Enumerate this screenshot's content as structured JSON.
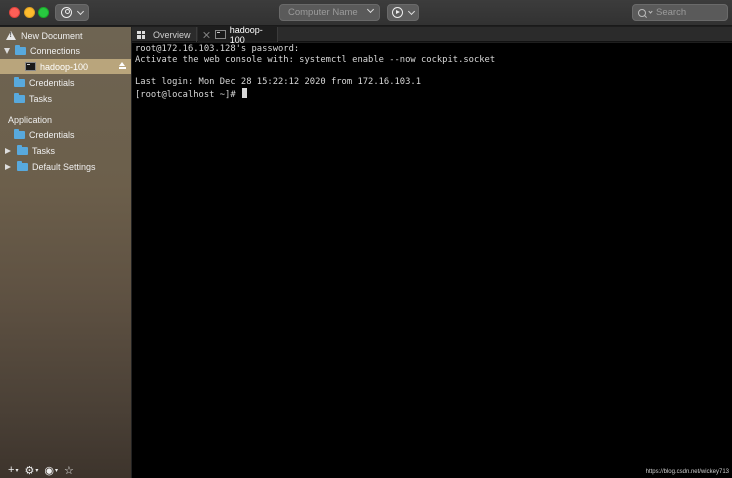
{
  "toolbar": {
    "computer_name_placeholder": "Computer Name",
    "search_placeholder": "Search"
  },
  "sidebar": {
    "new_document": "New Document",
    "connections_group": "Connections",
    "connection_items": [
      {
        "label": "hadoop-100",
        "icon": "terminal-icon",
        "selected": true
      },
      {
        "label": "Credentials",
        "icon": "folder-icon"
      },
      {
        "label": "Tasks",
        "icon": "folder-icon"
      }
    ],
    "application_header": "Application",
    "application_items": [
      {
        "label": "Credentials",
        "icon": "folder-icon"
      },
      {
        "label": "Tasks",
        "icon": "folder-icon",
        "disclosure": "collapsed"
      },
      {
        "label": "Default Settings",
        "icon": "folder-icon",
        "disclosure": "collapsed"
      }
    ],
    "bottom_controls": [
      "add-icon",
      "gear-icon",
      "globe-icon",
      "star-icon"
    ]
  },
  "tabs": [
    {
      "label": "Overview",
      "icon": "grid-icon"
    },
    {
      "label": "hadoop-100",
      "icon": "terminal-icon",
      "active": true
    }
  ],
  "terminal": {
    "lines": [
      "root@172.16.103.128's password:",
      "Activate the web console with: systemctl enable --now cockpit.socket",
      "",
      "Last login: Mon Dec 28 15:22:12 2020 from 172.16.103.1",
      "[root@localhost ~]# "
    ]
  },
  "watermark": "https://blog.csdn.net/wickey713",
  "colors": {
    "selection": "#b9a57c",
    "folder": "#58a9dd",
    "terminal_bg": "#000000",
    "terminal_fg": "#d8d8d8"
  }
}
